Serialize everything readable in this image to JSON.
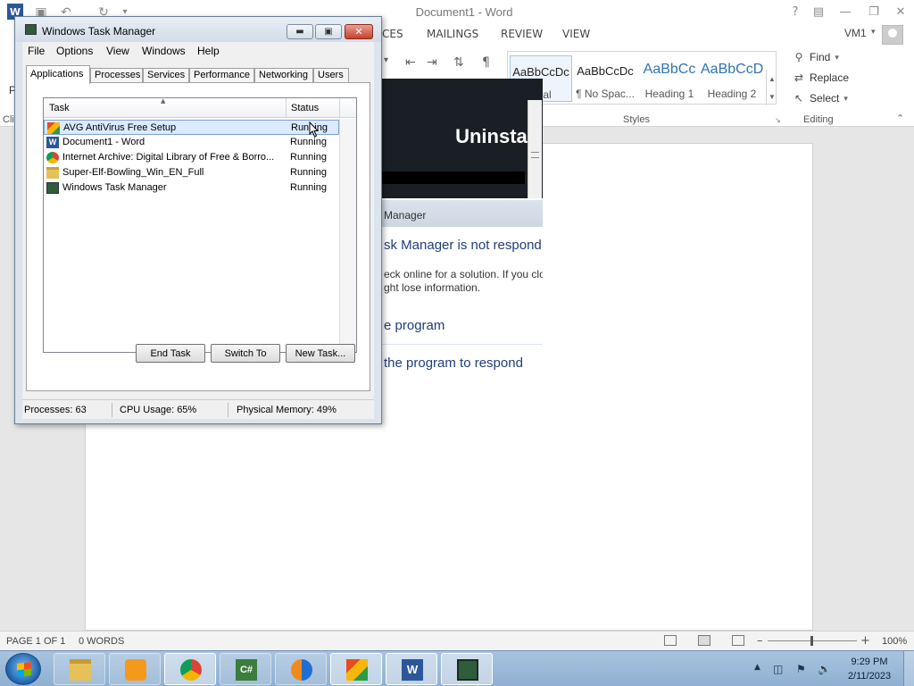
{
  "word": {
    "doc_title": "Document1 - Word",
    "tabs": [
      "CES",
      "MAILINGS",
      "REVIEW",
      "VIEW"
    ],
    "user": "VM1",
    "styles": [
      {
        "sample": "AaBbCcDc",
        "name": "rmal"
      },
      {
        "sample": "AaBbCcDc",
        "name": "¶ No Spac..."
      },
      {
        "sample": "AaBbCc",
        "name": "Heading 1"
      },
      {
        "sample": "AaBbCcD",
        "name": "Heading 2"
      }
    ],
    "group_styles": "Styles",
    "group_editing": "Editing",
    "edit_find": "Find",
    "edit_replace": "Replace",
    "edit_select": "Select",
    "left_cut_1": "P",
    "left_cut_2": "Cli",
    "status_page": "PAGE 1 OF 1",
    "status_words": "0 WORDS",
    "zoom": "100%",
    "zoom_level": 0.5
  },
  "avg_window": {
    "title_text": "Uninstall"
  },
  "not_responding": {
    "title": "Manager",
    "heading": "sk Manager is not respond",
    "body_line1": "eck online for a solution. If you clo",
    "body_line2": "ght lose information.",
    "option1": "e program",
    "option2": "the program to respond"
  },
  "task_manager": {
    "title": "Windows Task Manager",
    "menu": [
      "File",
      "Options",
      "View",
      "Windows",
      "Help"
    ],
    "tabs": [
      "Applications",
      "Processes",
      "Services",
      "Performance",
      "Networking",
      "Users"
    ],
    "columns": {
      "task": "Task",
      "status": "Status"
    },
    "rows": [
      {
        "task": "AVG AntiVirus Free Setup",
        "status": "Running",
        "icon": "avg-icon"
      },
      {
        "task": "Document1 - Word",
        "status": "Running",
        "icon": "word-icon"
      },
      {
        "task": "Internet Archive: Digital Library of Free & Borro...",
        "status": "Running",
        "icon": "chrome-icon"
      },
      {
        "task": "Super-Elf-Bowling_Win_EN_Full",
        "status": "Running",
        "icon": "folder-icon"
      },
      {
        "task": "Windows Task Manager",
        "status": "Running",
        "icon": "taskmanager-icon"
      }
    ],
    "buttons": {
      "end_task": "End Task",
      "switch_to": "Switch To",
      "new_task": "New Task..."
    },
    "status": {
      "processes": "Processes: 63",
      "cpu": "CPU Usage: 65%",
      "memory": "Physical Memory: 49%"
    }
  },
  "taskbar": {
    "apps": [
      "explorer",
      "media-player",
      "chrome",
      "csharp",
      "avg-secure",
      "avg",
      "word",
      "task-manager"
    ],
    "time": "9:29 PM",
    "date": "2/11/2023"
  }
}
